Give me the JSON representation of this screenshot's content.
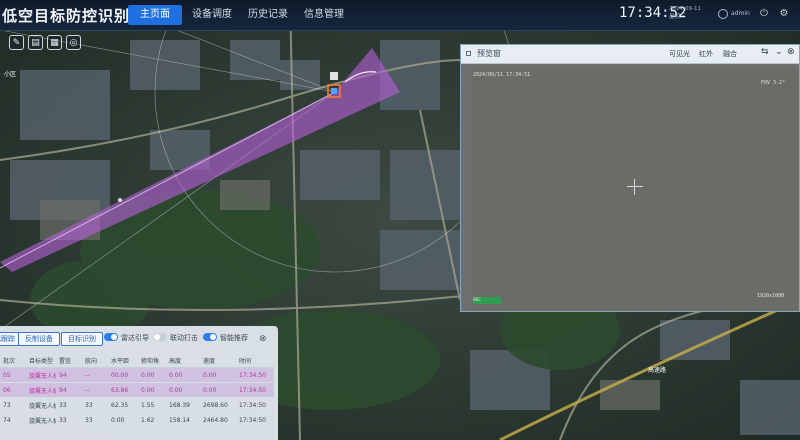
{
  "header": {
    "app_title": "低空目标防控识别系统",
    "tabs": [
      {
        "label": "主页面",
        "active": true
      },
      {
        "label": "设备调度",
        "active": false
      },
      {
        "label": "历史记录",
        "active": false
      },
      {
        "label": "信息管理",
        "active": false
      }
    ],
    "time": "17:34:52",
    "date": "2024-09-11",
    "weekday": "星期三",
    "user": "admin"
  },
  "video": {
    "title": "预览窗",
    "modes": [
      "可见光",
      "红外",
      "融合"
    ],
    "osd_top_left": "2024/09/11 17:34:51",
    "osd_top_right": "FOV 3.2°",
    "osd_bottom_right": "1920x1080",
    "rec_label": "REC"
  },
  "panel": {
    "buttons": [
      "目标跟踪",
      "反制设备",
      "目标识别"
    ],
    "toggles": [
      {
        "label": "雷达引导",
        "on": true
      },
      {
        "label": "联动打击",
        "on": false
      },
      {
        "label": "智能推荐",
        "on": true
      }
    ],
    "columns": [
      "批次",
      "目标类型",
      "置信",
      "航向",
      "水平距",
      "俯仰角",
      "高度",
      "速度",
      "时间"
    ],
    "rows": [
      {
        "cells": [
          "05",
          "旋翼无人机",
          "94",
          "--",
          "00.00",
          "0.00",
          "0.00",
          "0.00",
          "17:34:50"
        ],
        "highlight": true
      },
      {
        "cells": [
          "06",
          "旋翼无人机",
          "94",
          "--",
          "63.86",
          "0.00",
          "0.00",
          "0.00",
          "17:34:50"
        ],
        "highlight": true
      },
      {
        "cells": [
          "73",
          "旋翼无人机",
          "33",
          "33",
          "62.35",
          "1.55",
          "168.39",
          "2698.60",
          "17:34:50"
        ],
        "highlight": false
      },
      {
        "cells": [
          "74",
          "旋翼无人机",
          "33",
          "33",
          "0.00",
          "1.62",
          "158.14",
          "2464.80",
          "17:34:50"
        ],
        "highlight": false
      }
    ]
  },
  "map": {
    "sector_color": "#b45fd6",
    "label_top_left": "小区",
    "label_bottom_right": "高速路"
  }
}
